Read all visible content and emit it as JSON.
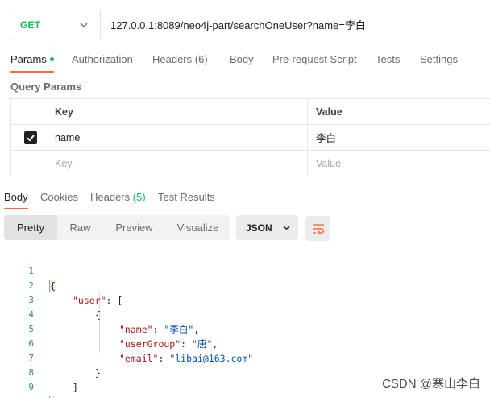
{
  "request": {
    "method": "GET",
    "url": "127.0.0.1:8089/neo4j-part/searchOneUser?name=李白",
    "method_color": "#0cbb52"
  },
  "request_tabs": {
    "params": "Params",
    "authorization": "Authorization",
    "headers": "Headers",
    "headers_count": "(6)",
    "body": "Body",
    "prerequest": "Pre-request Script",
    "tests": "Tests",
    "settings": "Settings"
  },
  "query_params": {
    "title": "Query Params",
    "col_key": "Key",
    "col_value": "Value",
    "rows": [
      {
        "checked": true,
        "key": "name",
        "value": "李白"
      }
    ],
    "placeholder_key": "Key",
    "placeholder_value": "Value"
  },
  "response_tabs": {
    "body": "Body",
    "cookies": "Cookies",
    "headers": "Headers",
    "headers_count": "(5)",
    "test_results": "Test Results"
  },
  "view_modes": {
    "pretty": "Pretty",
    "raw": "Raw",
    "preview": "Preview",
    "visualize": "Visualize",
    "format": "JSON"
  },
  "code_lines": {
    "n1": "1",
    "n2": "2",
    "n3": "3",
    "n4": "4",
    "n5": "5",
    "n6": "6",
    "n7": "7",
    "n8": "8",
    "n9": "9",
    "open_brace": "{",
    "user_key": "\"user\"",
    "open_bracket": "[",
    "obj_open": "{",
    "name_key": "\"name\"",
    "name_val": "\"李白\"",
    "group_key": "\"userGroup\"",
    "group_val": "\"唐\"",
    "email_key": "\"email\"",
    "email_val": "\"libai@163.com\"",
    "obj_close": "}",
    "close_bracket": "]",
    "close_brace": "}"
  },
  "accent_color": "#ff6c37",
  "watermark": "CSDN @寒山李白"
}
